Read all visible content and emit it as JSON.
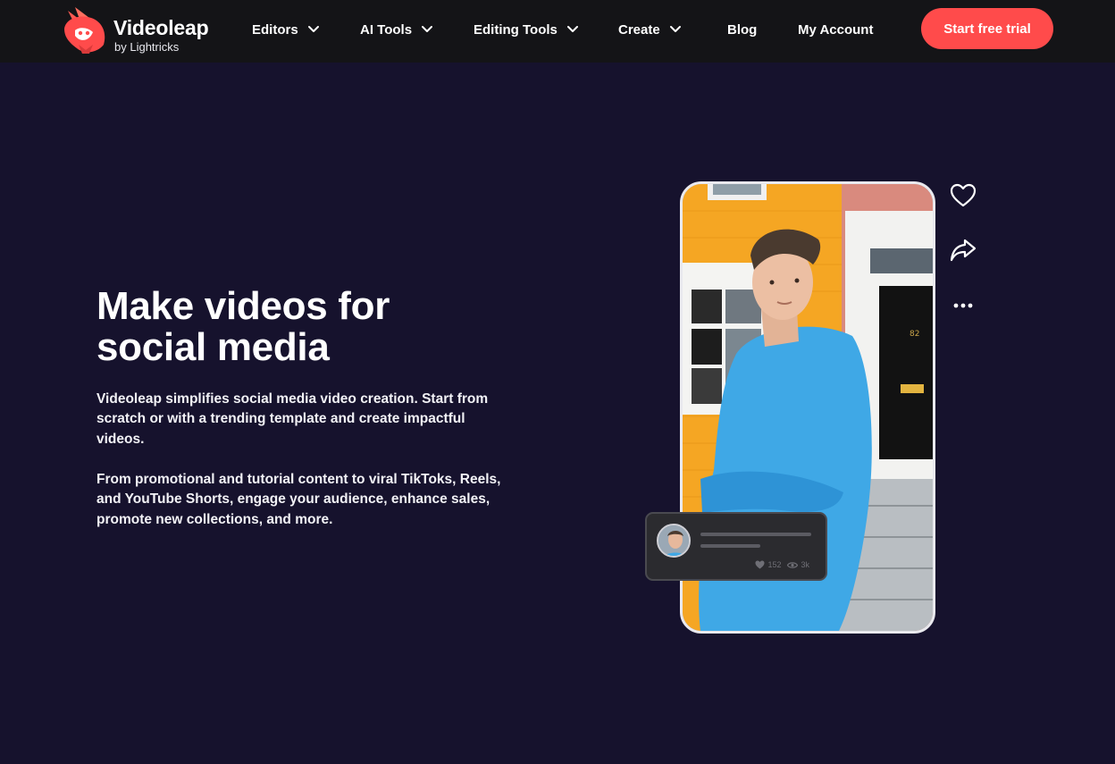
{
  "brand": {
    "name": "Videoleap",
    "byline": "by Lightricks",
    "accent": "#ff4b4b",
    "page_background": "#16122d",
    "nav_background": "#141417"
  },
  "nav": {
    "items": [
      {
        "label": "Editors",
        "has_dropdown": true
      },
      {
        "label": "AI Tools",
        "has_dropdown": true
      },
      {
        "label": "Editing Tools",
        "has_dropdown": true
      },
      {
        "label": "Create",
        "has_dropdown": true
      },
      {
        "label": "Blog",
        "has_dropdown": false
      },
      {
        "label": "My Account",
        "has_dropdown": false
      }
    ],
    "cta_label": "Start free trial"
  },
  "hero": {
    "title_lines": [
      "Make videos for",
      "social media"
    ],
    "paragraph1_lines": [
      "Videoleap simplifies social media video creation. Start from",
      "scratch or with a trending template and create impactful",
      "videos."
    ],
    "paragraph2_lines": [
      "From promotional and tutorial content to viral TikToks, Reels,",
      "and YouTube Shorts, engage your audience, enhance sales,",
      "promote new collections, and more."
    ]
  },
  "preview": {
    "house_number": "82",
    "side_actions": [
      "heart-icon",
      "share-arrow-icon",
      "more-dots-icon"
    ],
    "comment": {
      "likes": "152",
      "views": "3k"
    }
  }
}
